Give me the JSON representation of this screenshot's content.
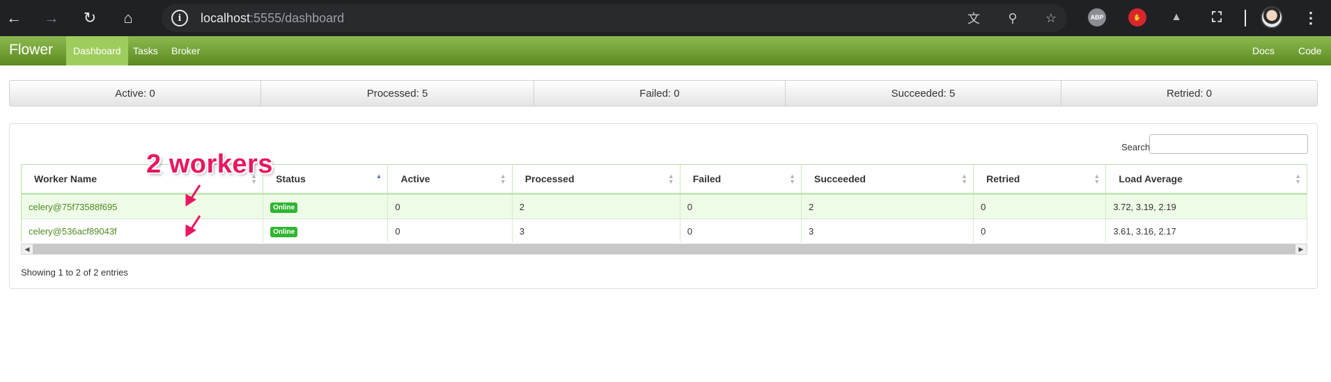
{
  "browser": {
    "url_host": "localhost",
    "url_rest": ":5555/dashboard",
    "extensions": [
      {
        "name": "abp-extension-icon",
        "label": "ABP"
      },
      {
        "name": "hand-extension-icon",
        "label": ""
      },
      {
        "name": "angular-extension-icon",
        "label": ""
      }
    ]
  },
  "navbar": {
    "brand": "Flower",
    "items": [
      {
        "label": "Dashboard",
        "active": true
      },
      {
        "label": "Tasks",
        "active": false
      },
      {
        "label": "Broker",
        "active": false
      }
    ],
    "right_items": [
      {
        "label": "Docs"
      },
      {
        "label": "Code"
      }
    ]
  },
  "stats": [
    {
      "label": "Active: 0"
    },
    {
      "label": "Processed: 5"
    },
    {
      "label": "Failed: 0"
    },
    {
      "label": "Succeeded: 5"
    },
    {
      "label": "Retried: 0"
    }
  ],
  "search": {
    "label": "Search:",
    "value": ""
  },
  "table": {
    "columns": [
      "Worker Name",
      "Status",
      "Active",
      "Processed",
      "Failed",
      "Succeeded",
      "Retried",
      "Load Average"
    ],
    "rows": [
      {
        "worker": "celery@75f73588f695",
        "status": "Online",
        "active": "0",
        "processed": "2",
        "failed": "0",
        "succeeded": "2",
        "retried": "0",
        "load": "3.72, 3.19, 2.19"
      },
      {
        "worker": "celery@536acf89043f",
        "status": "Online",
        "active": "0",
        "processed": "3",
        "failed": "0",
        "succeeded": "3",
        "retried": "0",
        "load": "3.61, 3.16, 2.17"
      }
    ],
    "footer": "Showing 1 to 2 of 2 entries"
  },
  "annotation": {
    "text": "2 workers",
    "color": "#e8175f"
  }
}
